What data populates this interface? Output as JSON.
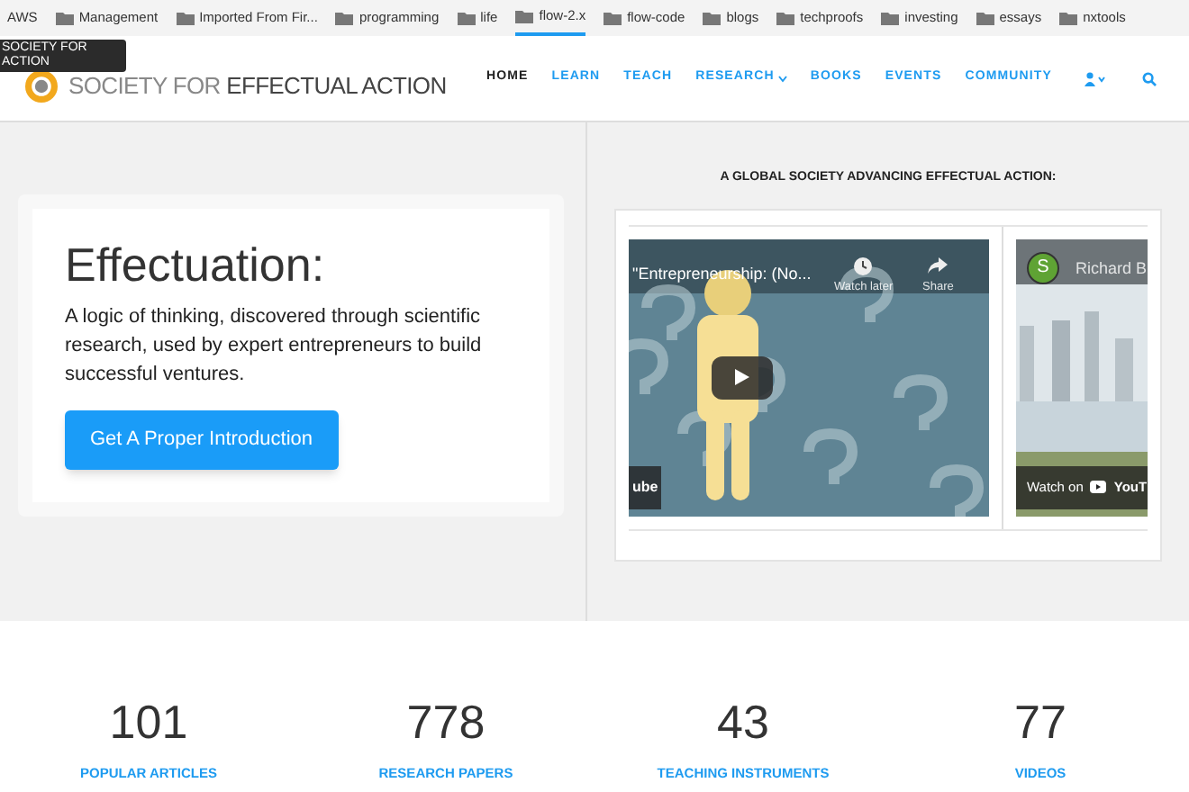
{
  "bookmarks": [
    {
      "label": "AWS",
      "kind": "link",
      "selected": false
    },
    {
      "label": "Management",
      "kind": "folder",
      "selected": false
    },
    {
      "label": "Imported From Fir...",
      "kind": "folder",
      "selected": false
    },
    {
      "label": "programming",
      "kind": "folder",
      "selected": false
    },
    {
      "label": "life",
      "kind": "folder",
      "selected": false
    },
    {
      "label": "flow-2.x",
      "kind": "folder",
      "selected": true
    },
    {
      "label": "flow-code",
      "kind": "folder",
      "selected": false
    },
    {
      "label": "blogs",
      "kind": "folder",
      "selected": false
    },
    {
      "label": "techproofs",
      "kind": "folder",
      "selected": false
    },
    {
      "label": "investing",
      "kind": "folder",
      "selected": false
    },
    {
      "label": "essays",
      "kind": "folder",
      "selected": false
    },
    {
      "label": "nxtools",
      "kind": "folder",
      "selected": false
    }
  ],
  "tooltip": "SOCIETY FOR\nACTION",
  "header": {
    "logo_light": "SOCIETY FOR",
    "logo_dark": "EFFECTUAL ACTION",
    "nav": [
      {
        "label": "HOME",
        "selected": true,
        "dropdown": false
      },
      {
        "label": "LEARN",
        "selected": false,
        "dropdown": false
      },
      {
        "label": "TEACH",
        "selected": false,
        "dropdown": false
      },
      {
        "label": "RESEARCH",
        "selected": false,
        "dropdown": true
      },
      {
        "label": "BOOKS",
        "selected": false,
        "dropdown": false
      },
      {
        "label": "EVENTS",
        "selected": false,
        "dropdown": false
      },
      {
        "label": "COMMUNITY",
        "selected": false,
        "dropdown": false
      }
    ]
  },
  "hero": {
    "title": "Effectuation:",
    "text": "A logic of thinking, discovered through scientific research, used by expert entrepreneurs to build successful ventures.",
    "button": "Get A Proper Introduction"
  },
  "videos_heading": "A GLOBAL SOCIETY ADVANCING EFFECTUAL ACTION:",
  "videos": [
    {
      "title": "\"Entrepreneurship: (No...",
      "watch_later": "Watch later",
      "share": "Share",
      "badge": "ube"
    },
    {
      "avatar": "S",
      "channel": "Richard B",
      "watch_on": "Watch on",
      "badge": "YouT"
    }
  ],
  "stats": [
    {
      "value": "101",
      "label": "POPULAR ARTICLES"
    },
    {
      "value": "778",
      "label": "RESEARCH PAPERS"
    },
    {
      "value": "43",
      "label": "TEACHING INSTRUMENTS"
    },
    {
      "value": "77",
      "label": "VIDEOS"
    }
  ]
}
